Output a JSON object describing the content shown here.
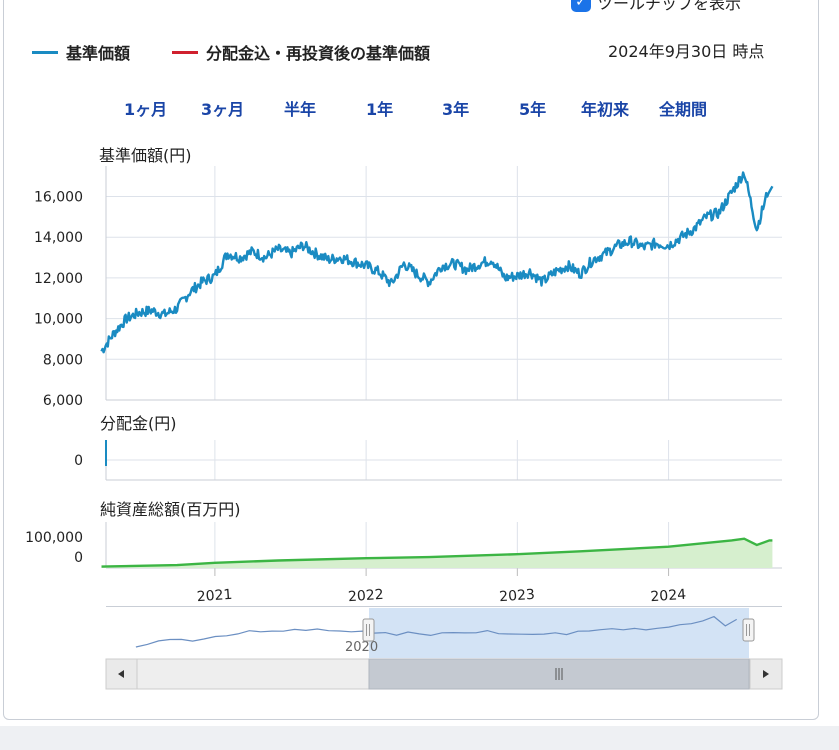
{
  "tooltip_toggle": {
    "label": "ツールチップを表示",
    "checked": true
  },
  "legend": [
    {
      "label": "基準価額",
      "color": "#1a8bc2"
    },
    {
      "label": "分配金込・再投資後の基準価額",
      "color": "#d0202e"
    }
  ],
  "as_of": "2024年9月30日 時点",
  "range_buttons": [
    "1ヶ月",
    "3ヶ月",
    "半年",
    "1年",
    "3年",
    "5年",
    "年初来",
    "全期間"
  ],
  "panels": {
    "nav_title": "基準価額(円)",
    "dist_title": "分配金(円)",
    "aum_title": "純資産総額(百万円)"
  },
  "navigator": {
    "year_label": "2020"
  },
  "chart_data": [
    {
      "type": "line",
      "title": "基準価額(円)",
      "ylim": [
        6000,
        17500
      ],
      "yticks": [
        "6,000",
        "8,000",
        "10,000",
        "12,000",
        "14,000",
        "16,000"
      ],
      "xticks": [
        "2021",
        "2022",
        "2023",
        "2024"
      ],
      "series": [
        {
          "name": "基準価額",
          "color": "#1a8bc2",
          "points": [
            [
              "2020-04",
              8400
            ],
            [
              "2020-05",
              9300
            ],
            [
              "2020-06",
              10000
            ],
            [
              "2020-07",
              10300
            ],
            [
              "2020-08",
              10400
            ],
            [
              "2020-09",
              10200
            ],
            [
              "2020-10",
              10500
            ],
            [
              "2020-11",
              11300
            ],
            [
              "2020-12",
              11800
            ],
            [
              "2021-01",
              12100
            ],
            [
              "2021-02",
              13200
            ],
            [
              "2021-03",
              13000
            ],
            [
              "2021-04",
              13300
            ],
            [
              "2021-05",
              13000
            ],
            [
              "2021-06",
              13400
            ],
            [
              "2021-07",
              13200
            ],
            [
              "2021-08",
              13600
            ],
            [
              "2021-09",
              13200
            ],
            [
              "2021-10",
              12900
            ],
            [
              "2021-11",
              13000
            ],
            [
              "2021-12",
              12800
            ],
            [
              "2022-01",
              12600
            ],
            [
              "2022-02",
              12300
            ],
            [
              "2022-03",
              11700
            ],
            [
              "2022-04",
              12700
            ],
            [
              "2022-05",
              12200
            ],
            [
              "2022-06",
              11800
            ],
            [
              "2022-07",
              12600
            ],
            [
              "2022-08",
              12700
            ],
            [
              "2022-09",
              12400
            ],
            [
              "2022-10",
              12700
            ],
            [
              "2022-11",
              12900
            ],
            [
              "2022-12",
              12000
            ],
            [
              "2023-01",
              12100
            ],
            [
              "2023-02",
              12300
            ],
            [
              "2023-03",
              11800
            ],
            [
              "2023-04",
              12300
            ],
            [
              "2023-05",
              12600
            ],
            [
              "2023-06",
              12200
            ],
            [
              "2023-07",
              12900
            ],
            [
              "2023-08",
              13200
            ],
            [
              "2023-09",
              13600
            ],
            [
              "2023-10",
              13800
            ],
            [
              "2023-11",
              13500
            ],
            [
              "2023-12",
              13700
            ],
            [
              "2024-01",
              13600
            ],
            [
              "2024-02",
              14000
            ],
            [
              "2024-03",
              14400
            ],
            [
              "2024-04",
              15000
            ],
            [
              "2024-05",
              15200
            ],
            [
              "2024-06",
              16200
            ],
            [
              "2024-07",
              17200
            ],
            [
              "2024-08",
              14400
            ],
            [
              "2024-09",
              16500
            ]
          ]
        }
      ]
    },
    {
      "type": "line",
      "title": "分配金(円)",
      "yticks": [
        "0"
      ],
      "series": [
        {
          "name": "分配金",
          "values": [
            0
          ]
        }
      ]
    },
    {
      "type": "area",
      "title": "純資産総額(百万円)",
      "ylim": [
        0,
        160000
      ],
      "yticks": [
        "0",
        "100,000"
      ],
      "series": [
        {
          "name": "純資産総額",
          "color": "#3cb544",
          "points": [
            [
              "2020-04",
              5000
            ],
            [
              "2020-10",
              10000
            ],
            [
              "2021-01",
              18000
            ],
            [
              "2021-06",
              26000
            ],
            [
              "2022-01",
              34000
            ],
            [
              "2022-06",
              38000
            ],
            [
              "2023-01",
              48000
            ],
            [
              "2023-06",
              58000
            ],
            [
              "2024-01",
              74000
            ],
            [
              "2024-06",
              96000
            ],
            [
              "2024-07",
              102000
            ],
            [
              "2024-08",
              80000
            ],
            [
              "2024-09",
              96000
            ]
          ]
        }
      ]
    }
  ]
}
